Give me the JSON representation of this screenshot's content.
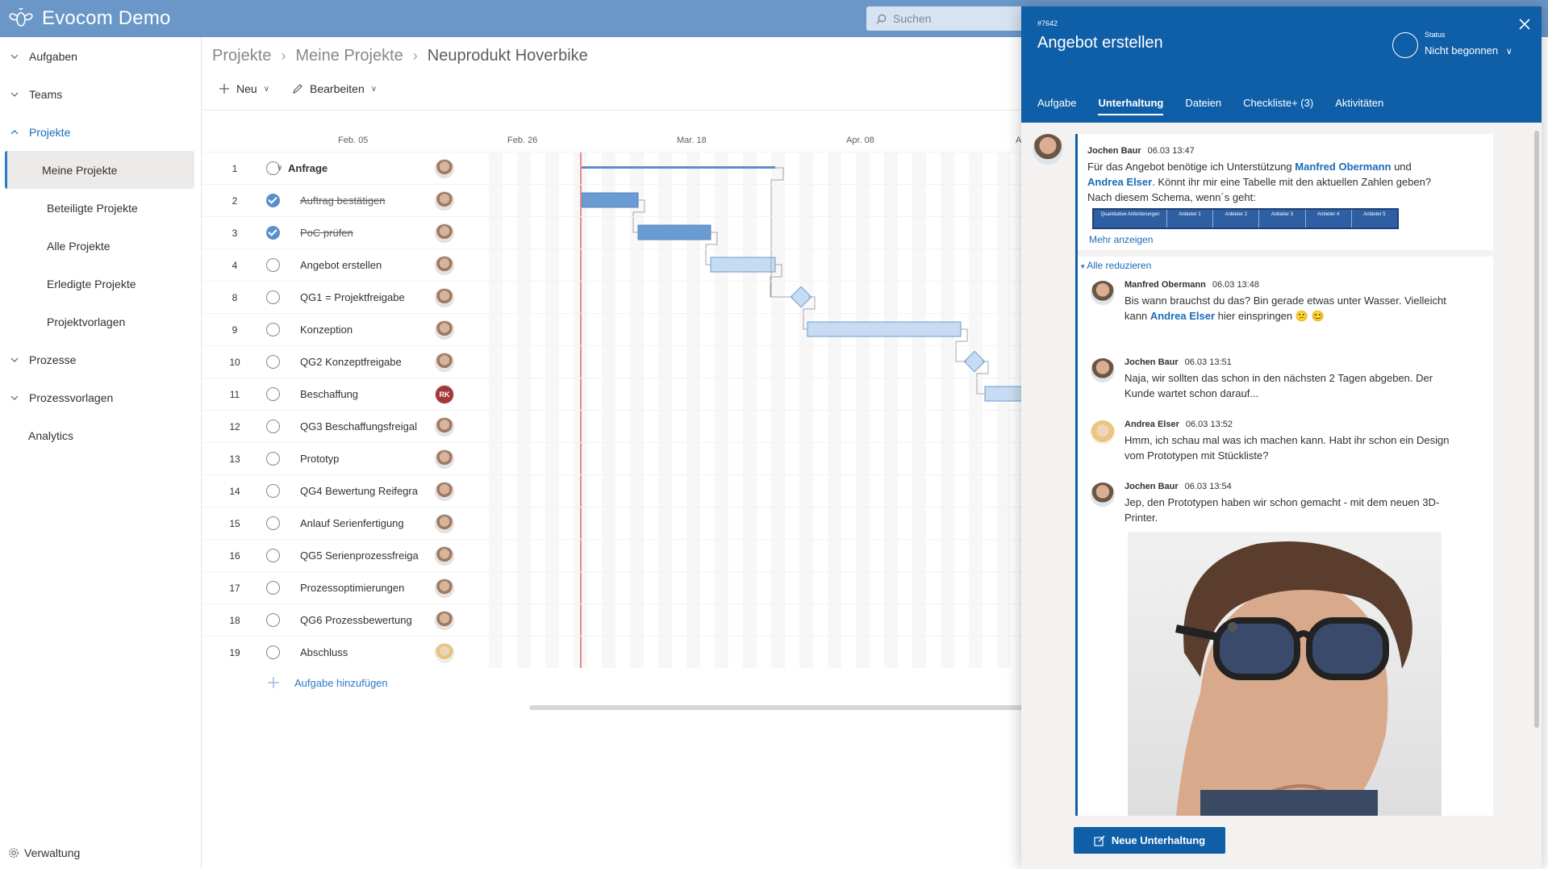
{
  "app": {
    "title": "Evocom Demo"
  },
  "search": {
    "placeholder": "Suchen"
  },
  "sidebar": {
    "items": [
      {
        "label": "Aufgaben"
      },
      {
        "label": "Teams"
      },
      {
        "label": "Projekte"
      },
      {
        "label": "Prozesse"
      },
      {
        "label": "Prozessvorlagen"
      },
      {
        "label": "Analytics"
      }
    ],
    "projekte_sub": [
      {
        "label": "Meine Projekte"
      },
      {
        "label": "Beteiligte Projekte"
      },
      {
        "label": "Alle Projekte"
      },
      {
        "label": "Erledigte Projekte"
      },
      {
        "label": "Projektvorlagen"
      }
    ],
    "admin": "Verwaltung"
  },
  "breadcrumb": [
    "Projekte",
    "Meine Projekte",
    "Neuprodukt Hoverbike"
  ],
  "toolbar": {
    "new_label": "Neu",
    "edit_label": "Bearbeiten"
  },
  "gantt": {
    "dates": [
      "Feb. 05",
      "Feb. 26",
      "Mar. 18",
      "Apr. 08",
      "A"
    ],
    "rows": [
      {
        "num": "1",
        "name": "Anfrage",
        "group": true,
        "done": false
      },
      {
        "num": "2",
        "name": "Auftrag bestätigen",
        "done": true
      },
      {
        "num": "3",
        "name": "PoC prüfen",
        "done": true
      },
      {
        "num": "4",
        "name": "Angebot erstellen",
        "done": false
      },
      {
        "num": "8",
        "name": "QG1 = Projektfreigabe",
        "done": false
      },
      {
        "num": "9",
        "name": "Konzeption",
        "done": false
      },
      {
        "num": "10",
        "name": "QG2 Konzeptfreigabe",
        "done": false
      },
      {
        "num": "11",
        "name": "Beschaffung",
        "done": false,
        "avatar": "RK"
      },
      {
        "num": "12",
        "name": "QG3 Beschaffungsfreigal",
        "done": false
      },
      {
        "num": "13",
        "name": "Prototyp",
        "done": false
      },
      {
        "num": "14",
        "name": "QG4 Bewertung Reifegra",
        "done": false
      },
      {
        "num": "15",
        "name": "Anlauf Serienfertigung",
        "done": false
      },
      {
        "num": "16",
        "name": "QG5 Serienprozessfreiga",
        "done": false
      },
      {
        "num": "17",
        "name": "Prozessoptimierungen",
        "done": false
      },
      {
        "num": "18",
        "name": "QG6 Prozessbewertung",
        "done": false
      },
      {
        "num": "19",
        "name": "Abschluss",
        "done": false
      }
    ],
    "add_task": "Aufgabe hinzufügen"
  },
  "panel": {
    "id": "#7642",
    "title": "Angebot erstellen",
    "status_label": "Status",
    "status_value": "Nicht begonnen",
    "tabs": [
      "Aufgabe",
      "Unterhaltung",
      "Dateien",
      "Checkliste+ (3)",
      "Aktivitäten"
    ],
    "msg1": {
      "author": "Jochen Baur",
      "time": "06.03 13:47",
      "t1": "Für das Angebot benötige ich Unterstützung ",
      "m1": "Manfred Obermann",
      "t2": " und",
      "m2": "Andrea Elser",
      "t3": ". Könnt ihr mir eine Tabelle mit den aktuellen Zahlen geben?",
      "t4": "Nach diesem Schema, wenn´s geht:",
      "table_headers": [
        "Quantitative Anforderungen",
        "Anbieter 1",
        "Anbieter 2",
        "Anbieter 3",
        "Anbieter 4",
        "Anbieter 5"
      ]
    },
    "more": "Mehr anzeigen",
    "collapse": "Alle reduzieren",
    "msg2": {
      "author": "Manfred Obermann",
      "time": "06.03 13:48",
      "t1": "Bis wann brauchst du das? Bin gerade etwas unter Wasser. Vielleicht",
      "t2": "kann ",
      "m1": "Andrea Elser",
      "t3": " hier einspringen 😕 😊"
    },
    "msg3": {
      "author": "Jochen Baur",
      "time": "06.03 13:51",
      "t1": "Naja, wir sollten das schon in den nächsten 2 Tagen abgeben. Der",
      "t2": "Kunde wartet schon darauf..."
    },
    "msg4": {
      "author": "Andrea Elser",
      "time": "06.03 13:52",
      "t1": "Hmm, ich schau mal was ich machen kann. Habt ihr schon ein Design",
      "t2": "vom Prototypen mit Stückliste?"
    },
    "msg5": {
      "author": "Jochen Baur",
      "time": "06.03 13:54",
      "t1": "Jep, den Prototypen haben wir schon gemacht - mit dem neuen 3D-",
      "t2": "Printer."
    },
    "new_conversation": "Neue Unterhaltung"
  }
}
